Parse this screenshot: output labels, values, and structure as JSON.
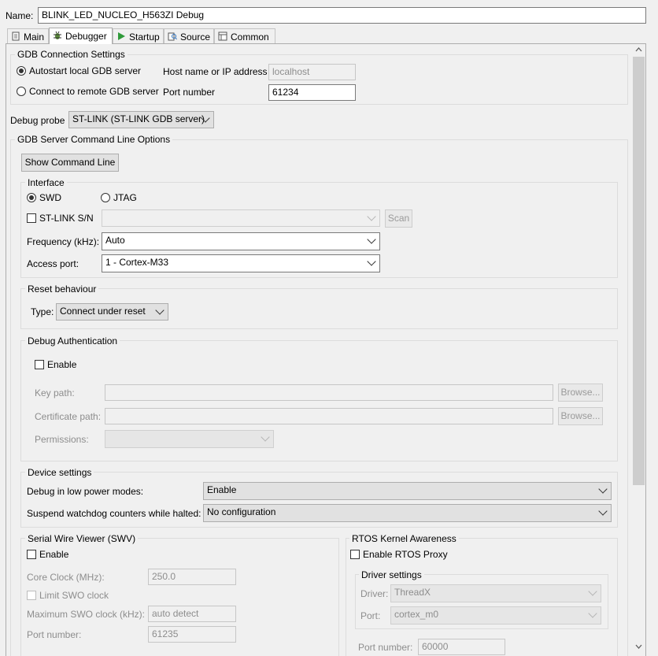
{
  "name": {
    "label": "Name:",
    "value": "BLINK_LED_NUCLEO_H563ZI Debug"
  },
  "tabs": [
    {
      "label": "Main",
      "icon": "main-tab-icon"
    },
    {
      "label": "Debugger",
      "icon": "debugger-bug-icon",
      "active": true
    },
    {
      "label": "Startup",
      "icon": "startup-play-icon"
    },
    {
      "label": "Source",
      "icon": "source-lookup-icon"
    },
    {
      "label": "Common",
      "icon": "common-tab-icon"
    }
  ],
  "gdb": {
    "title": "GDB Connection Settings",
    "autostart": "Autostart local GDB server",
    "remote": "Connect to remote GDB server",
    "host_label": "Host name or IP address",
    "host_value": "localhost",
    "port_label": "Port number",
    "port_value": "61234"
  },
  "probe": {
    "label": "Debug probe",
    "value": "ST-LINK (ST-LINK GDB server)"
  },
  "server": {
    "title": "GDB Server Command Line Options",
    "show_cmd": "Show Command Line",
    "interface": {
      "title": "Interface",
      "swd": "SWD",
      "jtag": "JTAG",
      "stlink_sn": "ST-LINK S/N",
      "scan": "Scan",
      "freq_label": "Frequency (kHz):",
      "freq_value": "Auto",
      "ap_label": "Access port:",
      "ap_value": "1 - Cortex-M33"
    },
    "reset": {
      "title": "Reset behaviour",
      "type_label": "Type:",
      "type_value": "Connect under reset"
    },
    "auth": {
      "title": "Debug Authentication",
      "enable": "Enable",
      "key_label": "Key path:",
      "cert_label": "Certificate path:",
      "perm_label": "Permissions:",
      "browse": "Browse..."
    },
    "device": {
      "title": "Device settings",
      "lowpower_label": "Debug in low power modes:",
      "lowpower_value": "Enable",
      "watchdog_label": "Suspend watchdog counters while halted:",
      "watchdog_value": "No configuration"
    },
    "swv": {
      "title": "Serial Wire Viewer (SWV)",
      "enable": "Enable",
      "core_clock_label": "Core Clock (MHz):",
      "core_clock_value": "250.0",
      "limit_swo": "Limit SWO clock",
      "max_swo_label": "Maximum SWO clock (kHz):",
      "max_swo_value": "auto detect",
      "port_label": "Port number:",
      "port_value": "61235"
    },
    "rtos": {
      "title": "RTOS Kernel Awareness",
      "enable_proxy": "Enable RTOS Proxy",
      "driver_settings": "Driver settings",
      "driver_label": "Driver:",
      "driver_value": "ThreadX",
      "port_label": "Port:",
      "port_value": "cortex_m0",
      "port_number_label": "Port number:",
      "port_number_value": "60000"
    }
  }
}
